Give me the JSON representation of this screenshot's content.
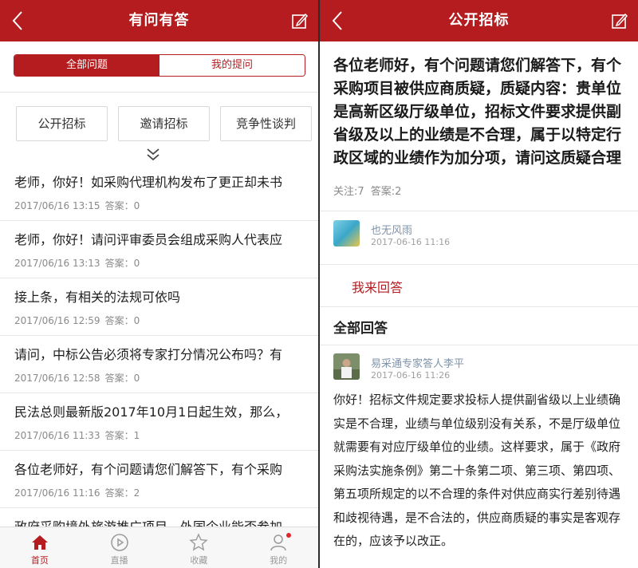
{
  "left": {
    "title": "有问有答",
    "segments": {
      "all": "全部问题",
      "mine": "我的提问"
    },
    "categories": [
      "公开招标",
      "邀请招标",
      "竞争性谈判"
    ],
    "questions": [
      {
        "title": "老师，你好！如采购代理机构发布了更正却未书",
        "date": "2017/06/16 13:15",
        "answers_label": "答案：0"
      },
      {
        "title": "老师，你好！请问评审委员会组成采购人代表应",
        "date": "2017/06/16 13:13",
        "answers_label": "答案：0"
      },
      {
        "title": "接上条，有相关的法规可依吗",
        "date": "2017/06/16 12:59",
        "answers_label": "答案：0"
      },
      {
        "title": "请问，中标公告必须将专家打分情况公布吗？有",
        "date": "2017/06/16 12:58",
        "answers_label": "答案：0"
      },
      {
        "title": "民法总则最新版2017年10月1日起生效，那么，",
        "date": "2017/06/16 11:33",
        "answers_label": "答案：1"
      },
      {
        "title": "各位老师好，有个问题请您们解答下，有个采购",
        "date": "2017/06/16 11:16",
        "answers_label": "答案：2"
      },
      {
        "title": "政府采购境外旅游推广项目，外国企业能否参加",
        "date": "",
        "answers_label": ""
      }
    ],
    "tabbar": [
      {
        "label": "首页",
        "icon": "home-icon"
      },
      {
        "label": "直播",
        "icon": "play-icon"
      },
      {
        "label": "收藏",
        "icon": "star-icon"
      },
      {
        "label": "我的",
        "icon": "user-icon"
      }
    ]
  },
  "right": {
    "title": "公开招标",
    "question": "各位老师好，有个问题请您们解答下，有个采购项目被供应商质疑，质疑内容：贵单位是高新区级厅级单位，招标文件要求提供副省级及以上的业绩是不合理，属于以特定行政区域的业绩作为加分项，请问这质疑合理吗，该怎",
    "follow_label": "关注:7",
    "answer_count_label": "答案:2",
    "asker": {
      "name": "也无风雨",
      "date": "2017-06-16 11:16"
    },
    "reply_label": "我来回答",
    "all_answers_label": "全部回答",
    "answerer": {
      "name": "易采通专家答人李平",
      "date": "2017-06-16 11:26"
    },
    "answer_text": "你好！招标文件规定要求投标人提供副省级以上业绩确实是不合理，业绩与单位级别没有关系，不是厅级单位就需要有对应厅级单位的业绩。这样要求，属于《政府采购法实施条例》第二十条第二项、第三项、第四项、第五项所规定的以不合理的条件对供应商实行差别待遇和歧视待遇，是不合法的，供应商质疑的事实是客观存在的，应该予以改正。"
  },
  "colors": {
    "brand": "#b51c1f",
    "link": "#7f93aa",
    "muted": "#8a8a8a"
  }
}
